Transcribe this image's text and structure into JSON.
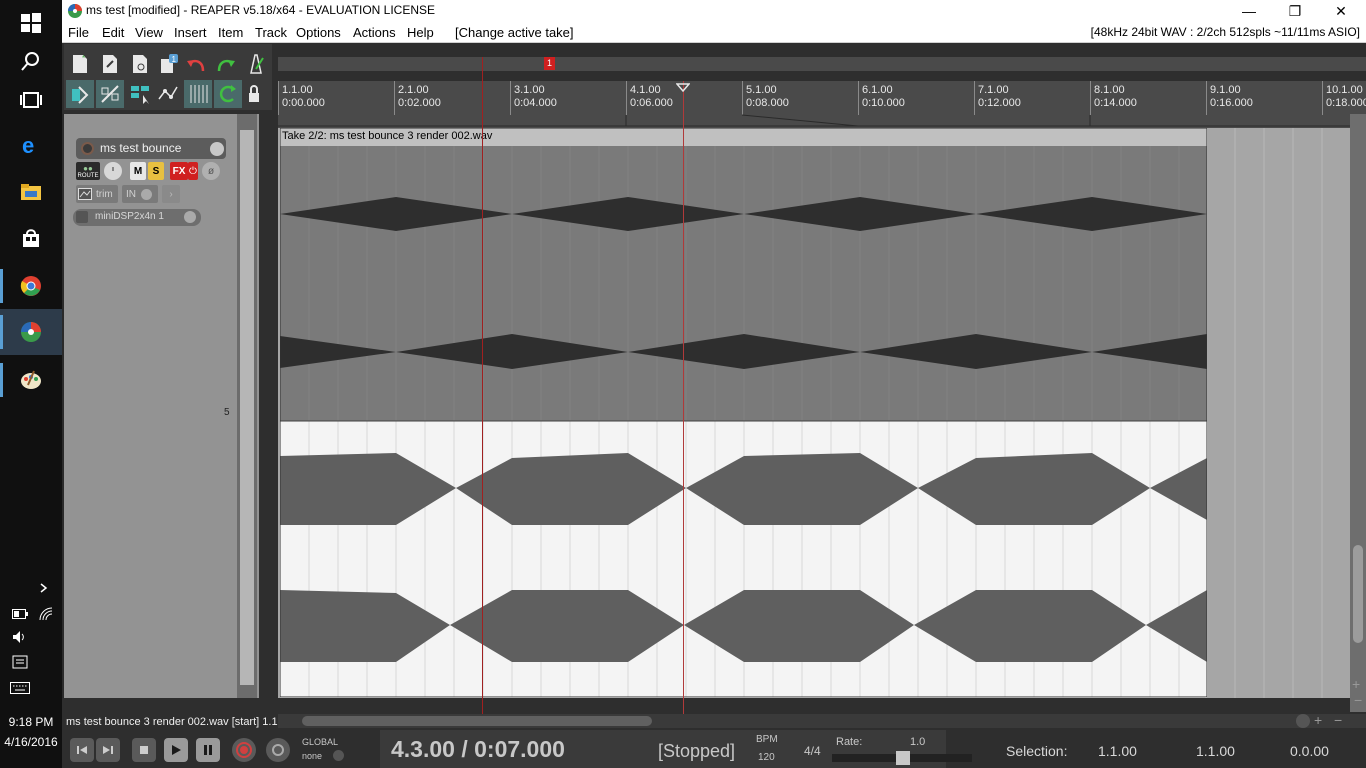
{
  "taskbar": {
    "apps": [
      "windows-start",
      "search",
      "task-view",
      "edge",
      "file-explorer",
      "store",
      "chrome",
      "reaper",
      "paint"
    ],
    "clock_time": "9:18 PM",
    "clock_date": "4/16/2016"
  },
  "window": {
    "title": "ms test [modified] - REAPER v5.18/x64 - EVALUATION LICENSE",
    "controls": [
      "minimize",
      "restore",
      "close"
    ]
  },
  "menu": {
    "items": [
      "File",
      "Edit",
      "View",
      "Insert",
      "Item",
      "Track",
      "Options",
      "Actions",
      "Help",
      "[Change active take]"
    ],
    "status": "[48kHz 24bit WAV : 2/2ch 512spls ~11/11ms ASIO]"
  },
  "toolbar": {
    "badge": "1"
  },
  "track": {
    "name": "ms test bounce",
    "route_label": "ROUTE",
    "mute_label": "M",
    "solo_label": "S",
    "fx_label": "FX",
    "trim_label": "trim",
    "input_label": "IN",
    "fx_chain": "miniDSP2x4n  1",
    "track_number": "5"
  },
  "ruler": {
    "measures": [
      "1.1.00",
      "2.1.00",
      "3.1.00",
      "4.1.00",
      "5.1.00",
      "6.1.00",
      "7.1.00",
      "8.1.00",
      "9.1.00",
      "10.1.00"
    ],
    "times": [
      "0:00.000",
      "0:02.000",
      "0:04.000",
      "0:06.000",
      "0:08.000",
      "0:10.000",
      "0:12.000",
      "0:14.000",
      "0:16.000",
      "0:18.000"
    ],
    "marker": "1"
  },
  "item": {
    "label": "Take 2/2: ms test bounce 3 render 002.wav"
  },
  "status_bar": {
    "item_info": "ms test bounce 3 render 002.wav [start] 1.1",
    "global_label": "GLOBAL",
    "global_mode": "none"
  },
  "transport": {
    "position": "4.3.00 / 0:07.000",
    "state": "[Stopped]",
    "bpm_label": "BPM",
    "bpm": "120",
    "time_sig": "4/4",
    "rate_label": "Rate:",
    "rate": "1.0",
    "selection_label": "Selection:",
    "selection_start": "1.1.00",
    "selection_end": "1.1.00",
    "selection_length": "0.0.00"
  }
}
